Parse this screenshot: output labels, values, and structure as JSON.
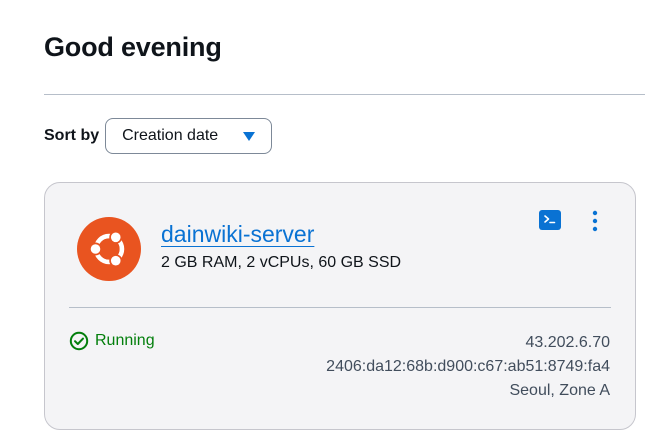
{
  "header": {
    "greeting": "Good evening"
  },
  "sort": {
    "label": "Sort by",
    "selected": "Creation date"
  },
  "instance": {
    "os_icon": "ubuntu-logo",
    "name": "dainwiki-server",
    "specs": "2 GB RAM, 2 vCPUs, 60 GB SSD",
    "status": "Running",
    "ipv4": "43.202.6.70",
    "ipv6": "2406:da12:68b:d900:c67:ab51:8749:fa4",
    "location": "Seoul, Zone A",
    "actions": {
      "terminal_icon": "terminal-icon",
      "menu_icon": "more-vertical-icon"
    }
  },
  "colors": {
    "accent": "#0972d3",
    "ubuntu_orange": "#e95420",
    "success": "#037f0c",
    "card_background": "#f4f4f6"
  }
}
